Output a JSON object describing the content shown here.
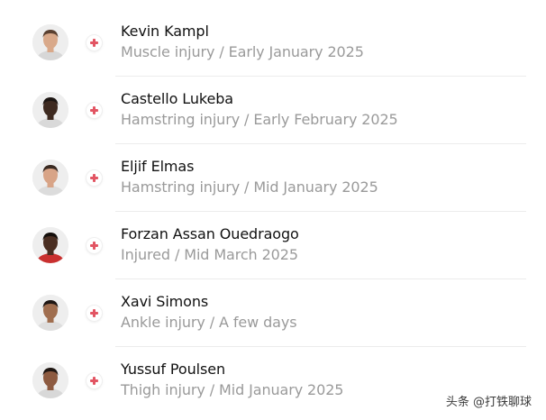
{
  "players": [
    {
      "name": "Kevin Kampl",
      "status": "Muscle injury / Early January 2025",
      "injury_icon": "medical-cross-icon",
      "colors": {
        "skin": "#d9a98a",
        "hair": "#5a4030",
        "shirt": "#d7d7d7"
      }
    },
    {
      "name": "Castello Lukeba",
      "status": "Hamstring injury / Early February 2025",
      "injury_icon": "medical-cross-icon",
      "colors": {
        "skin": "#3e2a20",
        "hair": "#1c1512",
        "shirt": "#d9d9d9"
      }
    },
    {
      "name": "Eljif Elmas",
      "status": "Hamstring injury / Mid January 2025",
      "injury_icon": "medical-cross-icon",
      "colors": {
        "skin": "#d8a487",
        "hair": "#3a2a22",
        "shirt": "#dcdcdc"
      }
    },
    {
      "name": "Forzan Assan Ouedraogo",
      "status": "Injured / Mid March 2025",
      "injury_icon": "medical-cross-icon",
      "colors": {
        "skin": "#4a2e22",
        "hair": "#140e0b",
        "shirt": "#c9302f"
      }
    },
    {
      "name": "Xavi Simons",
      "status": "Ankle injury / A few days",
      "injury_icon": "medical-cross-icon",
      "colors": {
        "skin": "#a06e4f",
        "hair": "#1f1714",
        "shirt": "#dedede"
      }
    },
    {
      "name": "Yussuf Poulsen",
      "status": "Thigh injury / Mid January 2025",
      "injury_icon": "medical-cross-icon",
      "colors": {
        "skin": "#8d5a40",
        "hair": "#1f1612",
        "shirt": "#d8d8d8"
      }
    }
  ],
  "theme": {
    "name_color": "#111111",
    "status_color": "#9a9a9a",
    "injury_cross_color": "#e25563",
    "divider_color": "#ececec"
  },
  "watermark": {
    "text": "头条 @打铁聊球"
  }
}
